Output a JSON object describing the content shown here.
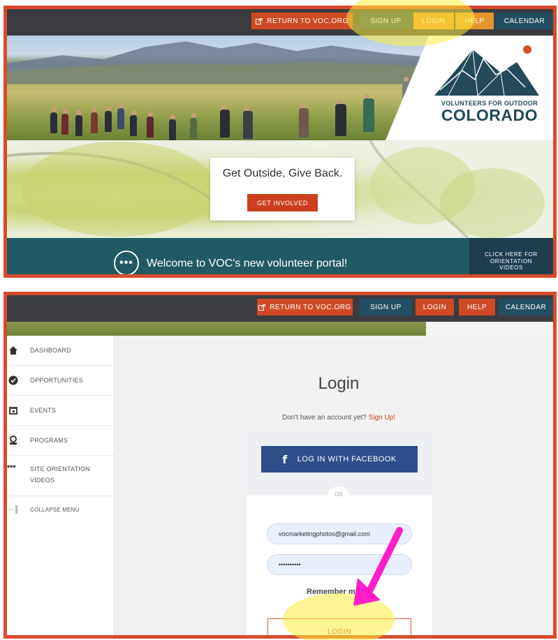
{
  "nav": {
    "return_label": "RETURN TO VOC.ORG",
    "signup_label": "SIGN UP",
    "login_label": "LOGIN",
    "help_label": "HELP",
    "calendar_label": "CALENDAR",
    "return_icon": "external-link-icon"
  },
  "hero": {
    "logo_line1": "VOLUNTEERS FOR OUTDOOR",
    "logo_line2": "COLORADO",
    "tagline": "Get Outside, Give Back.",
    "cta_label": "GET INVOLVED",
    "welcome_text": "Welcome to VOC's new volunteer portal!",
    "welcome_icon_glyph": "•••",
    "orientation_line1": "CLICK HERE FOR",
    "orientation_line2": "ORIENTATION",
    "orientation_line3": "VIDEOS"
  },
  "sidebar": {
    "items": [
      {
        "label": "DASHBOARD",
        "icon": "home-icon"
      },
      {
        "label": "OPPORTUNITIES",
        "icon": "check-circle-icon"
      },
      {
        "label": "EVENTS",
        "icon": "calendar-icon"
      },
      {
        "label": "PROGRAMS",
        "icon": "person-badge-icon"
      },
      {
        "label": "SITE ORIENTATION VIDEOS",
        "label_line1": "SITE ORIENTATION",
        "label_line2": "VIDEOS",
        "icon": "ellipsis-icon"
      },
      {
        "label": "COLLAPSE MENU",
        "icon": "collapse-icon"
      }
    ]
  },
  "login": {
    "title": "Login",
    "account_prompt": "Don't have an account yet?",
    "signup_link": "Sign Up!",
    "facebook_label": "LOG IN WITH FACEBOOK",
    "facebook_icon": "f",
    "or_label": "OR",
    "email_value": "vocmarketingphotos@gmail.com",
    "password_value": "••••••••••",
    "remember_label": "Remember me",
    "submit_label": "LOGIN"
  },
  "colors": {
    "frame": "#d84a2b",
    "nav_bg": "#3b3c40",
    "orange": "#cf4a24",
    "teal": "#224f63",
    "highlight": "#ffec3c",
    "arrow": "#ff1ec8"
  }
}
